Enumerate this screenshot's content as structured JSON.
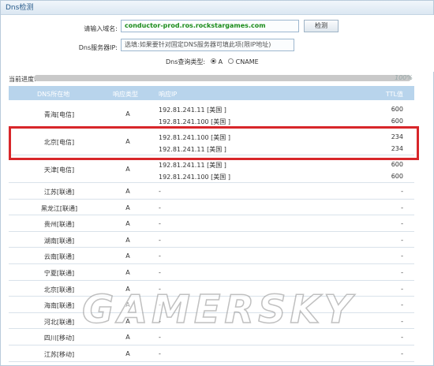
{
  "panel": {
    "title": "Dns检测"
  },
  "form": {
    "domain_label": "请输入域名:",
    "domain_value": "conductor-prod.ros.rockstargames.com",
    "check_button": "检测",
    "server_label": "Dns服务器IP:",
    "server_placeholder": "选填:如果要针对固定DNS服务器可填此项(限IP地址)",
    "query_type_label": "Dns查询类型:",
    "query_type_options": [
      "A",
      "CNAME"
    ],
    "query_type_selected": "A"
  },
  "progress": {
    "label": "当前进度:",
    "percent": 100,
    "percent_text": "100%"
  },
  "table": {
    "headers": [
      "DNS所在地",
      "响应类型",
      "响应IP",
      "TTL值"
    ],
    "rows": [
      {
        "location": "青海[电信]",
        "type": "A",
        "ips": [
          "192.81.241.11 [美国 ]",
          "192.81.241.100 [美国 ]"
        ],
        "ttls": [
          "600",
          "600"
        ]
      },
      {
        "location": "北京[电信]",
        "type": "A",
        "ips": [
          "192.81.241.100 [美国 ]",
          "192.81.241.11 [美国 ]"
        ],
        "ttls": [
          "234",
          "234"
        ]
      },
      {
        "location": "天津[电信]",
        "type": "A",
        "ips": [
          "192.81.241.11 [美国 ]",
          "192.81.241.100 [美国 ]"
        ],
        "ttls": [
          "600",
          "600"
        ]
      },
      {
        "location": "江苏[联通]",
        "type": "A",
        "ip": "-",
        "ttl": "-"
      },
      {
        "location": "黑龙江[联通]",
        "type": "A",
        "ip": "-",
        "ttl": "-"
      },
      {
        "location": "贵州[联通]",
        "type": "A",
        "ip": "-",
        "ttl": "-"
      },
      {
        "location": "湖南[联通]",
        "type": "A",
        "ip": "-",
        "ttl": "-"
      },
      {
        "location": "云南[联通]",
        "type": "A",
        "ip": "-",
        "ttl": "-"
      },
      {
        "location": "宁夏[联通]",
        "type": "A",
        "ip": "-",
        "ttl": "-"
      },
      {
        "location": "北京[联通]",
        "type": "A",
        "ip": "-",
        "ttl": "-"
      },
      {
        "location": "海南[联通]",
        "type": "A",
        "ip": "-",
        "ttl": "-"
      },
      {
        "location": "河北[联通]",
        "type": "A",
        "ip": "-",
        "ttl": "-"
      },
      {
        "location": "四川[移动]",
        "type": "A",
        "ip": "-",
        "ttl": "-"
      },
      {
        "location": "江苏[移动]",
        "type": "A",
        "ip": "-",
        "ttl": "-"
      }
    ]
  },
  "watermark": {
    "text": "GAMERSKY"
  },
  "colors": {
    "highlight": "#d8262a",
    "header_bg": "#b8d4ec",
    "domain_text": "#1a8c1a"
  }
}
